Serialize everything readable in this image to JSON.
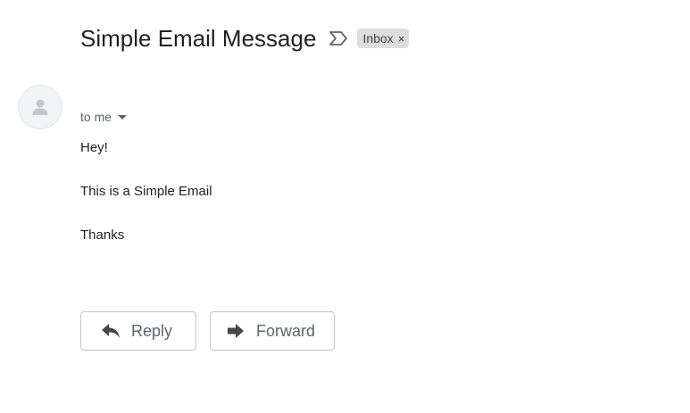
{
  "message": {
    "subject": "Simple Email Message",
    "label": "Inbox",
    "label_remove": "×",
    "recipients": "to me",
    "body": [
      "Hey!",
      "This is a Simple Email",
      "Thanks"
    ]
  },
  "actions": {
    "reply_label": "Reply",
    "forward_label": "Forward"
  },
  "icons": {
    "importance": "importance-marker-icon",
    "avatar": "person-avatar-icon",
    "reply": "reply-arrow-icon",
    "forward": "forward-arrow-icon"
  },
  "colors": {
    "label_chip": "#dddddd",
    "text_primary": "#202124",
    "text_secondary": "#5f6368",
    "button_border": "#c6c6c6"
  }
}
